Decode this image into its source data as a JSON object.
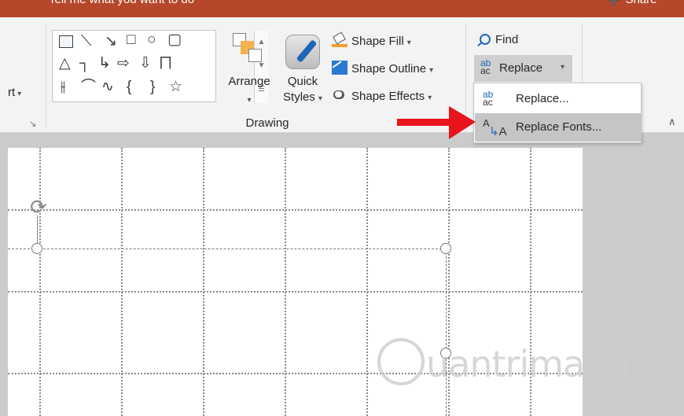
{
  "titlebar": {
    "tell_me": "Tell me what you want to do",
    "share": "Share",
    "bg_color": "#b7472a"
  },
  "ribbon": {
    "partial_label": "rt",
    "drawing_group_label": "Drawing",
    "arrange_label": "Arrange",
    "quick_styles_line1": "Quick",
    "quick_styles_line2": "Styles",
    "shape_fill": "Shape Fill",
    "shape_outline": "Shape Outline",
    "shape_effects": "Shape Effects",
    "find": "Find",
    "replace": "Replace",
    "shapes": [
      "text-box-shape-icon",
      "line-shape-icon",
      "arrow-line-shape-icon",
      "rectangle-shape-icon",
      "oval-shape-icon",
      "rounded-rectangle-shape-icon",
      "triangle-shape-icon",
      "elbow-connector-shape-icon",
      "elbow-arrow-connector-shape-icon",
      "right-arrow-shape-icon",
      "down-arrow-shape-icon",
      "freeform-shape-icon",
      "curve-shape-icon",
      "arc-shape-icon",
      "wave-shape-icon",
      "left-brace-shape-icon",
      "right-brace-shape-icon",
      "star-shape-icon"
    ]
  },
  "replace_menu": {
    "items": [
      {
        "label": "Replace...",
        "icon": "replace-icon"
      },
      {
        "label": "Replace Fonts...",
        "icon": "replace-fonts-icon"
      }
    ]
  },
  "icon_glyphs": {
    "ab": "ab",
    "ac": "ac",
    "A": "A"
  },
  "colors": {
    "accent": "#b7472a",
    "arrow": "#e8141b",
    "hover": "#c5c5c5"
  },
  "watermark": {
    "text": "uantrimang"
  }
}
